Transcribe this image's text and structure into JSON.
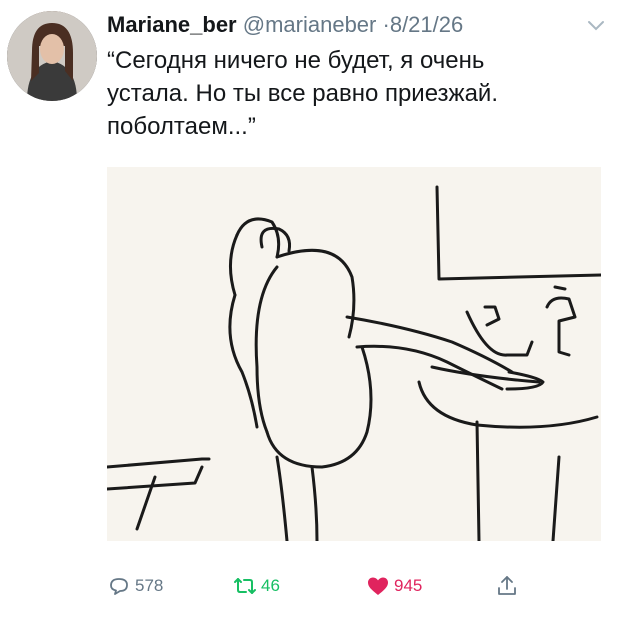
{
  "tweet": {
    "author_name": "Mariane_ber",
    "handle": "@marianeber",
    "separator": "·",
    "date": "8/21/26",
    "text_line1": "“Сегодня ничего не будет, я очень",
    "text_line2": "устала. Но ты все равно приезжай.",
    "text_line3": "поболтаем...”"
  },
  "actions": {
    "reply_count": "578",
    "retweet_count": "46",
    "like_count": "945"
  },
  "icons": {
    "chevron": "chevron-down-icon",
    "reply": "reply-icon",
    "retweet": "retweet-icon",
    "like": "heart-icon",
    "share": "share-icon"
  },
  "colors": {
    "retweet": "#17bf63",
    "like": "#e0245e",
    "muted": "#657786"
  }
}
